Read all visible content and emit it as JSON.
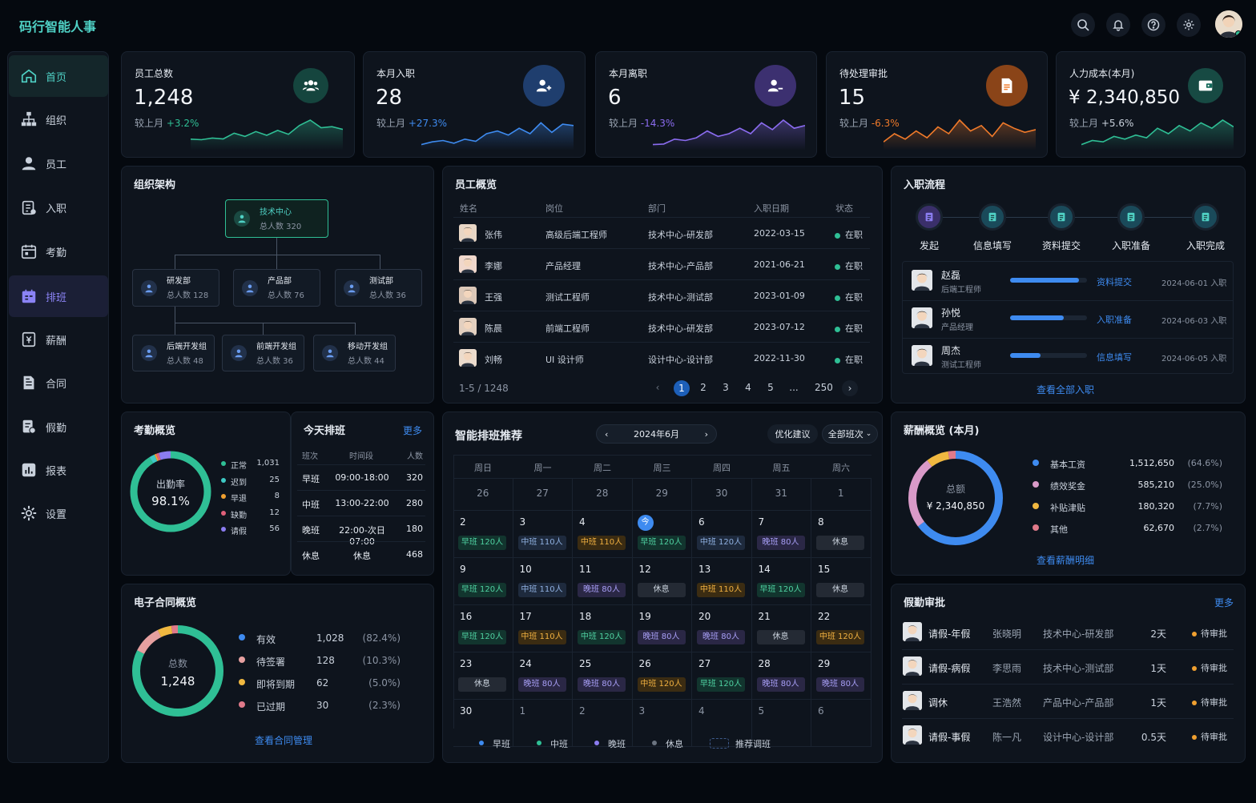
{
  "app": {
    "title": "码行智能人事"
  },
  "sidebar": {
    "items": [
      {
        "label": "首页",
        "icon": "home-icon"
      },
      {
        "label": "组织",
        "icon": "org-icon"
      },
      {
        "label": "员工",
        "icon": "user-icon"
      },
      {
        "label": "入职",
        "icon": "clipboard-icon"
      },
      {
        "label": "考勤",
        "icon": "calendar-icon"
      },
      {
        "label": "排班",
        "icon": "schedule-icon"
      },
      {
        "label": "薪酬",
        "icon": "salary-icon"
      },
      {
        "label": "合同",
        "icon": "document-icon"
      },
      {
        "label": "假勤",
        "icon": "leave-icon"
      },
      {
        "label": "报表",
        "icon": "report-icon"
      },
      {
        "label": "设置",
        "icon": "gear-icon"
      }
    ]
  },
  "stats": [
    {
      "label": "员工总数",
      "value": "1,248",
      "change_prefix": "较上月",
      "change": "+3.2%",
      "color": "#2fbf95"
    },
    {
      "label": "本月入职",
      "value": "28",
      "change_prefix": "较上月",
      "change": "+27.3%",
      "color": "#3e8bf0"
    },
    {
      "label": "本月离职",
      "value": "6",
      "change_prefix": "较上月",
      "change": "-14.3%",
      "color": "#8b6cf0"
    },
    {
      "label": "待处理审批",
      "value": "15",
      "change_prefix": "较上月",
      "change": "-6.3%",
      "color": "#f07a2a"
    },
    {
      "label": "人力成本(本月)",
      "value": "¥ 2,340,850",
      "change_prefix": "较上月",
      "change": "+5.6%",
      "color": "#2fbf95"
    }
  ],
  "org": {
    "title": "组织架构",
    "root": {
      "name": "技术中心",
      "count": "总人数 320"
    },
    "level1": [
      {
        "name": "研发部",
        "count": "总人数 128"
      },
      {
        "name": "产品部",
        "count": "总人数 76"
      },
      {
        "name": "测试部",
        "count": "总人数 36"
      }
    ],
    "level2": [
      {
        "name": "后端开发组",
        "count": "总人数 48"
      },
      {
        "name": "前端开发组",
        "count": "总人数 36"
      },
      {
        "name": "移动开发组",
        "count": "总人数 44"
      }
    ]
  },
  "employees": {
    "title": "员工概览",
    "headers": [
      "姓名",
      "岗位",
      "部门",
      "入职日期",
      "状态"
    ],
    "rows": [
      {
        "name": "张伟",
        "role": "高级后端工程师",
        "dept": "技术中心-研发部",
        "date": "2022-03-15",
        "status": "在职"
      },
      {
        "name": "李娜",
        "role": "产品经理",
        "dept": "技术中心-产品部",
        "date": "2021-06-21",
        "status": "在职"
      },
      {
        "name": "王强",
        "role": "测试工程师",
        "dept": "技术中心-测试部",
        "date": "2023-01-09",
        "status": "在职"
      },
      {
        "name": "陈晨",
        "role": "前端工程师",
        "dept": "技术中心-研发部",
        "date": "2023-07-12",
        "status": "在职"
      },
      {
        "name": "刘畅",
        "role": "UI 设计师",
        "dept": "设计中心-设计部",
        "date": "2022-11-30",
        "status": "在职"
      }
    ],
    "range": "1-5 / 1248",
    "pages": [
      "1",
      "2",
      "3",
      "4",
      "5",
      "...",
      "250"
    ]
  },
  "onboarding": {
    "title": "入职流程",
    "steps": [
      "发起",
      "信息填写",
      "资料提交",
      "入职准备",
      "入职完成"
    ],
    "people": [
      {
        "name": "赵磊",
        "role": "后端工程师",
        "stage": "资料提交",
        "date": "2024-06-01 入职",
        "progress": 0.9
      },
      {
        "name": "孙悦",
        "role": "产品经理",
        "stage": "入职准备",
        "date": "2024-06-03 入职",
        "progress": 0.7
      },
      {
        "name": "周杰",
        "role": "测试工程师",
        "stage": "信息填写",
        "date": "2024-06-05 入职",
        "progress": 0.4
      }
    ],
    "link": "查看全部入职"
  },
  "attendance": {
    "title": "考勤概览",
    "center_label": "出勤率",
    "center_value": "98.1%",
    "items": [
      {
        "label": "正常",
        "value": "1,031",
        "color": "#2fbf95"
      },
      {
        "label": "迟到",
        "value": "25",
        "color": "#3ec9c4"
      },
      {
        "label": "早退",
        "value": "8",
        "color": "#f0a030"
      },
      {
        "label": "缺勤",
        "value": "12",
        "color": "#e0607a"
      },
      {
        "label": "请假",
        "value": "56",
        "color": "#8b7cf0"
      }
    ]
  },
  "today_shift": {
    "title": "今天排班",
    "more": "更多",
    "headers": [
      "班次",
      "时间段",
      "人数"
    ],
    "rows": [
      {
        "shift": "早班",
        "time": "09:00-18:00",
        "count": "320"
      },
      {
        "shift": "中班",
        "time": "13:00-22:00",
        "count": "280"
      },
      {
        "shift": "晚班",
        "time": "22:00-次日07:00",
        "count": "180"
      },
      {
        "shift": "休息",
        "time": "休息",
        "count": "468"
      }
    ]
  },
  "schedule": {
    "title": "智能排班推荐",
    "month": "2024年6月",
    "optimize": "优化建议",
    "filter": "全部班次",
    "weekdays": [
      "周日",
      "周一",
      "周二",
      "周三",
      "周四",
      "周五",
      "周六"
    ],
    "today_label": "今",
    "weeks": [
      [
        {
          "d": "26",
          "dim": true
        },
        {
          "d": "27",
          "dim": true
        },
        {
          "d": "28",
          "dim": true
        },
        {
          "d": "29",
          "dim": true
        },
        {
          "d": "30",
          "dim": true
        },
        {
          "d": "31",
          "dim": true
        },
        {
          "d": "1",
          "dim": true
        }
      ],
      [
        {
          "d": "2",
          "t": "早班 120人",
          "k": "e"
        },
        {
          "d": "3",
          "t": "中班 110人",
          "k": "mm"
        },
        {
          "d": "4",
          "t": "中班 110人",
          "k": "m"
        },
        {
          "d": "5",
          "t": "早班 120人",
          "k": "e",
          "today": true
        },
        {
          "d": "6",
          "t": "中班 120人",
          "k": "mm"
        },
        {
          "d": "7",
          "t": "晚班 80人",
          "k": "n"
        },
        {
          "d": "8",
          "t": "休息",
          "k": "r"
        }
      ],
      [
        {
          "d": "9",
          "t": "早班 120人",
          "k": "e"
        },
        {
          "d": "10",
          "t": "中班 110人",
          "k": "mm"
        },
        {
          "d": "11",
          "t": "晚班 80人",
          "k": "n"
        },
        {
          "d": "12",
          "t": "休息",
          "k": "r"
        },
        {
          "d": "13",
          "t": "中班 110人",
          "k": "m"
        },
        {
          "d": "14",
          "t": "早班 120人",
          "k": "e"
        },
        {
          "d": "15",
          "t": "休息",
          "k": "r"
        }
      ],
      [
        {
          "d": "16",
          "t": "早班 120人",
          "k": "e"
        },
        {
          "d": "17",
          "t": "中班 110人",
          "k": "m"
        },
        {
          "d": "18",
          "t": "中班 120人",
          "k": "e"
        },
        {
          "d": "19",
          "t": "晚班 80人",
          "k": "n"
        },
        {
          "d": "20",
          "t": "晚班 80人",
          "k": "n"
        },
        {
          "d": "21",
          "t": "休息",
          "k": "r"
        },
        {
          "d": "22",
          "t": "中班 120人",
          "k": "m"
        }
      ],
      [
        {
          "d": "23",
          "t": "休息",
          "k": "r"
        },
        {
          "d": "24",
          "t": "晚班 80人",
          "k": "n"
        },
        {
          "d": "25",
          "t": "晚班 80人",
          "k": "n"
        },
        {
          "d": "26",
          "t": "中班 120人",
          "k": "m"
        },
        {
          "d": "27",
          "t": "早班 120人",
          "k": "e"
        },
        {
          "d": "28",
          "t": "晚班 80人",
          "k": "n"
        },
        {
          "d": "29",
          "t": "晚班 80人",
          "k": "n"
        }
      ],
      [
        {
          "d": "30"
        },
        {
          "d": "1",
          "dim": true
        },
        {
          "d": "2",
          "dim": true
        },
        {
          "d": "3",
          "dim": true
        },
        {
          "d": "4",
          "dim": true
        },
        {
          "d": "5",
          "dim": true
        },
        {
          "d": "6",
          "dim": true
        }
      ]
    ],
    "legend": [
      {
        "label": "早班",
        "color": "#3e8bf0"
      },
      {
        "label": "中班",
        "color": "#2fbf95"
      },
      {
        "label": "晚班",
        "color": "#8b7cf0"
      },
      {
        "label": "休息",
        "color": "#6b7480"
      },
      {
        "label": "推荐调班",
        "color": "dashed"
      }
    ]
  },
  "salary": {
    "title": "薪酬概览 (本月)",
    "center_label": "总额",
    "center_value": "¥ 2,340,850",
    "items": [
      {
        "label": "基本工资",
        "value": "1,512,650",
        "pct": "(64.6%)",
        "color": "#3e8bf0"
      },
      {
        "label": "绩效奖金",
        "value": "585,210",
        "pct": "(25.0%)",
        "color": "#d99ac8"
      },
      {
        "label": "补贴津贴",
        "value": "180,320",
        "pct": "(7.7%)",
        "color": "#f0b840"
      },
      {
        "label": "其他",
        "value": "62,670",
        "pct": "(2.7%)",
        "color": "#e07a8a"
      }
    ],
    "link": "查看薪酬明细"
  },
  "contract": {
    "title": "电子合同概览",
    "center_label": "总数",
    "center_value": "1,248",
    "items": [
      {
        "label": "有效",
        "value": "1,028",
        "pct": "(82.4%)",
        "color": "#3e8bf0"
      },
      {
        "label": "待签署",
        "value": "128",
        "pct": "(10.3%)",
        "color": "#e6a0a0"
      },
      {
        "label": "即将到期",
        "value": "62",
        "pct": "(5.0%)",
        "color": "#f0b840"
      },
      {
        "label": "已过期",
        "value": "30",
        "pct": "(2.3%)",
        "color": "#e07a8a"
      }
    ],
    "link": "查看合同管理"
  },
  "leave": {
    "title": "假勤审批",
    "more": "更多",
    "rows": [
      {
        "type": "请假-年假",
        "name": "张晓明",
        "dept": "技术中心-研发部",
        "days": "2天",
        "status": "待审批"
      },
      {
        "type": "请假-病假",
        "name": "李思雨",
        "dept": "技术中心-测试部",
        "days": "1天",
        "status": "待审批"
      },
      {
        "type": "调休",
        "name": "王浩然",
        "dept": "产品中心-产品部",
        "days": "1天",
        "status": "待审批"
      },
      {
        "type": "请假-事假",
        "name": "陈一凡",
        "dept": "设计中心-设计部",
        "days": "0.5天",
        "status": "待审批"
      }
    ]
  }
}
